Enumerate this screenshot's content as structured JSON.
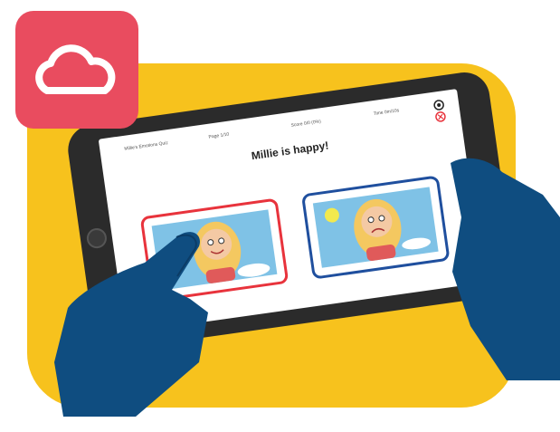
{
  "header": {
    "quiz_name": "Millie's Emotions Quiz",
    "page": "Page 1/10",
    "score": "Score 0/0 (0%)",
    "time": "Time 0m/10s"
  },
  "question": {
    "text": "Millie is happy!"
  },
  "answers": [
    {
      "label": "happy",
      "selected": true,
      "border_color": "#e8333c"
    },
    {
      "label": "sad",
      "selected": false,
      "border_color": "#1f4f9e"
    }
  ],
  "colors": {
    "background_shape": "#f7c21d",
    "cloud_badge": "#e94c5f",
    "hand": "#0f4d80",
    "tablet": "#2b2b2b"
  },
  "icons": [
    "cloud-icon",
    "record-icon",
    "close-icon"
  ]
}
